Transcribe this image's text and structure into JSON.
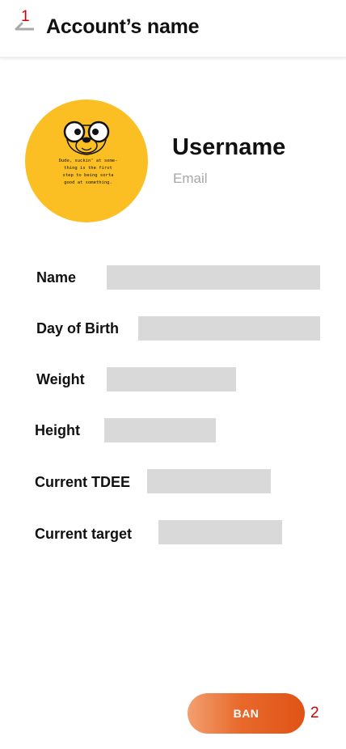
{
  "annotations": {
    "back": "1",
    "ban": "2"
  },
  "header": {
    "title": "Account’s name",
    "back_icon": "arrow-left-icon"
  },
  "profile": {
    "avatar_quote": "Dude, suckin’ at some-thing is the first step to being sorta good at something.",
    "username": "Username",
    "email": "Email"
  },
  "fields": [
    {
      "label": "Name"
    },
    {
      "label": "Day of Birth"
    },
    {
      "label": "Weight"
    },
    {
      "label": "Height"
    },
    {
      "label": "Current TDEE"
    },
    {
      "label": "Current target"
    }
  ],
  "actions": {
    "ban_label": "BAN"
  },
  "colors": {
    "avatar_bg": "#fbbf24",
    "field_placeholder": "#d9d9d9",
    "ban_gradient_start": "#f2a070",
    "ban_gradient_end": "#e05316",
    "annotation": "#d10000"
  }
}
